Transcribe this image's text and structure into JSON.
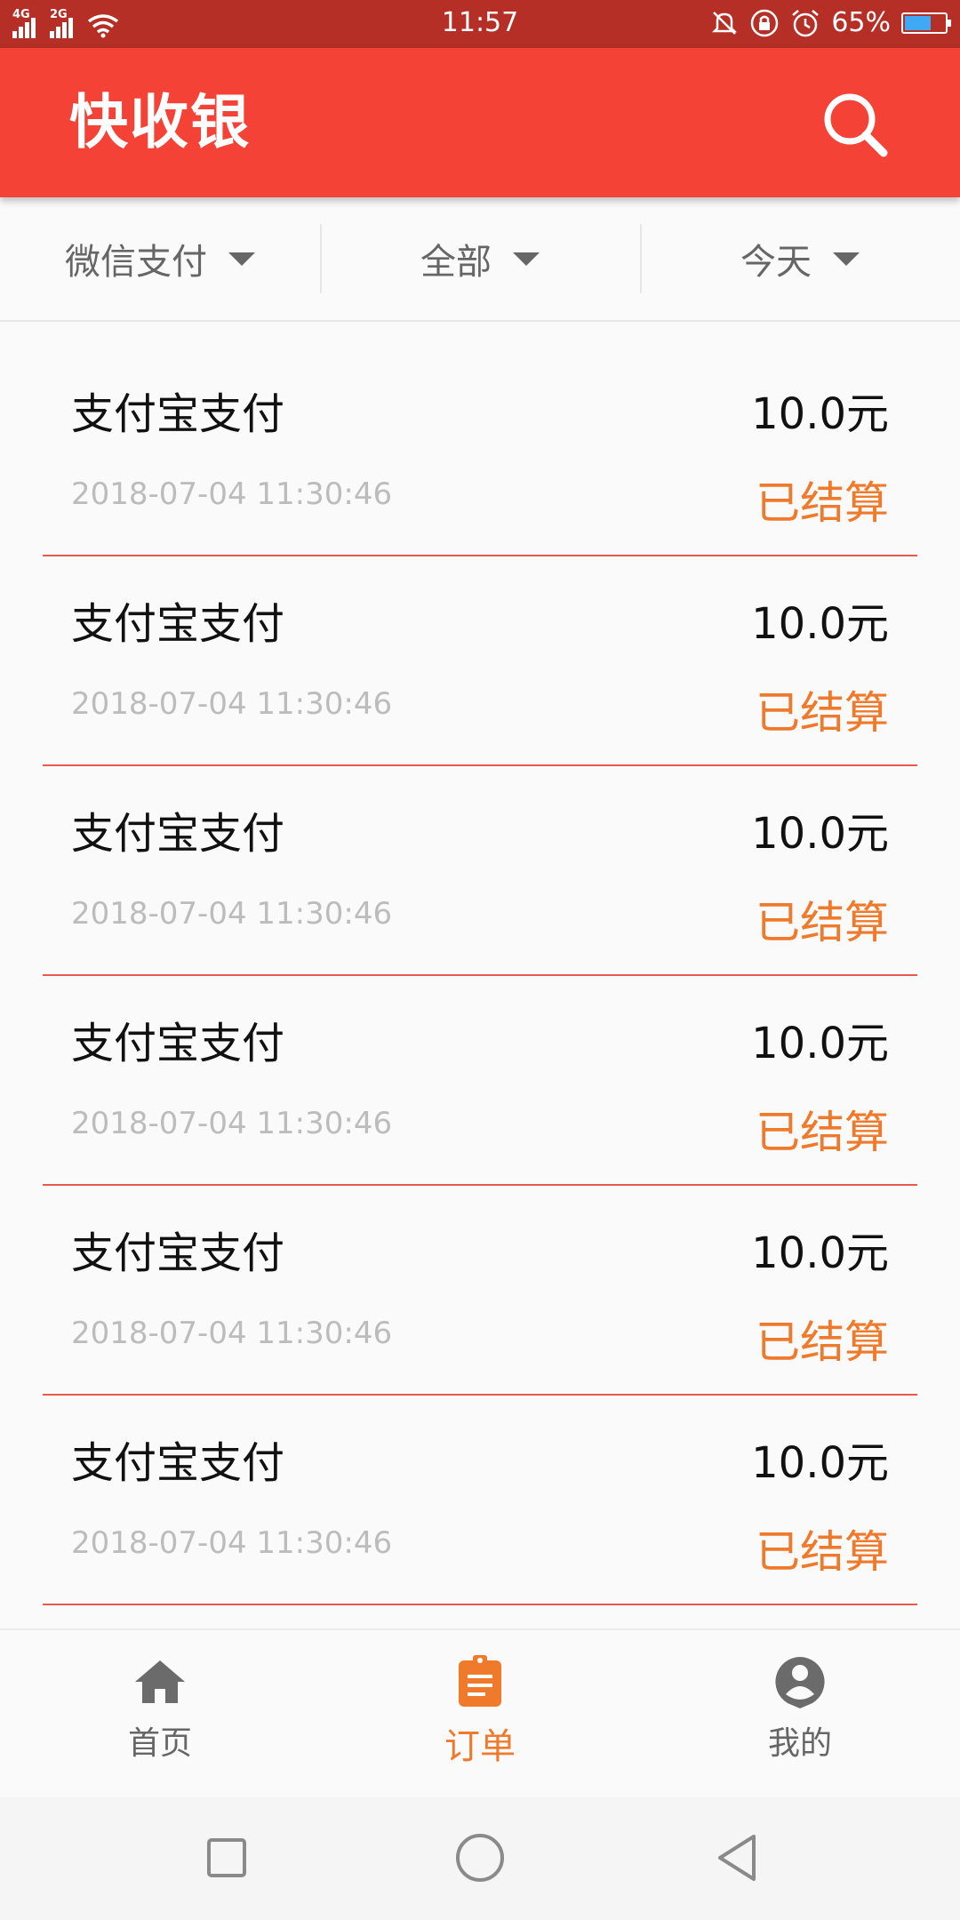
{
  "status_bar": {
    "net1": "4G",
    "net2": "2G",
    "time": "11:57",
    "battery": "65%",
    "battery_level": 0.65
  },
  "app_bar": {
    "title": "快收银",
    "search_icon": "search-icon"
  },
  "filters": [
    {
      "label": "微信支付"
    },
    {
      "label": "全部"
    },
    {
      "label": "今天"
    }
  ],
  "orders": [
    {
      "method": "支付宝支付",
      "datetime": "2018-07-04   11:30:46",
      "amount": "10.0元",
      "status": "已结算"
    },
    {
      "method": "支付宝支付",
      "datetime": "2018-07-04   11:30:46",
      "amount": "10.0元",
      "status": "已结算"
    },
    {
      "method": "支付宝支付",
      "datetime": "2018-07-04   11:30:46",
      "amount": "10.0元",
      "status": "已结算"
    },
    {
      "method": "支付宝支付",
      "datetime": "2018-07-04   11:30:46",
      "amount": "10.0元",
      "status": "已结算"
    },
    {
      "method": "支付宝支付",
      "datetime": "2018-07-04   11:30:46",
      "amount": "10.0元",
      "status": "已结算"
    },
    {
      "method": "支付宝支付",
      "datetime": "2018-07-04   11:30:46",
      "amount": "10.0元",
      "status": "已结算"
    }
  ],
  "bottom_nav": [
    {
      "label": "首页",
      "icon": "home-icon"
    },
    {
      "label": "订单",
      "icon": "clipboard-icon",
      "active": true
    },
    {
      "label": "我的",
      "icon": "profile-icon"
    }
  ],
  "colors": {
    "primary": "#f44336",
    "status_bar": "#b52f26",
    "accent": "#f07a2c",
    "divider": "#e8584f"
  }
}
